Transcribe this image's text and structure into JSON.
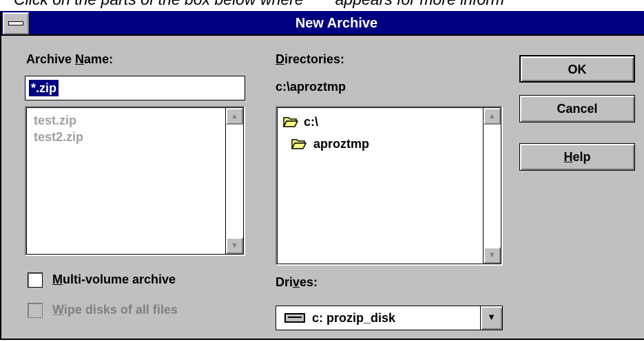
{
  "help_text": {
    "before": "Click on the parts of the box below where",
    "after": "appears for more inform"
  },
  "dialog": {
    "title": "New Archive"
  },
  "archive_name": {
    "label_pre": "Archive ",
    "label_key": "N",
    "label_post": "ame:",
    "value": "*.zip"
  },
  "archive_list": {
    "items": [
      "test.zip",
      "test2.zip"
    ]
  },
  "directories": {
    "label_key": "D",
    "label_post": "irectories:",
    "current_path": "c:\\aproztmp",
    "items": [
      "c:\\",
      "aproztmp"
    ]
  },
  "drives": {
    "label_pre": "Dri",
    "label_key": "v",
    "label_post": "es:",
    "selected": "c: prozip_disk"
  },
  "buttons": {
    "ok": "OK",
    "cancel": "Cancel",
    "help_key": "H",
    "help_post": "elp"
  },
  "options": {
    "multi_volume": {
      "key": "M",
      "post": "ulti-volume archive",
      "checked": false,
      "enabled": true
    },
    "wipe_disks": {
      "key": "W",
      "post": "ipe disks of all files",
      "checked": false,
      "enabled": false
    }
  },
  "icons": {
    "system_menu": "system-menu-icon",
    "scroll_up": "scroll-up-arrow-icon",
    "scroll_down": "scroll-down-arrow-icon",
    "folder_open": "open-folder-icon",
    "drive": "hard-drive-icon",
    "dropdown": "dropdown-arrow-icon"
  },
  "colors": {
    "titlebar": "#000080",
    "dialog_bg": "#c0c0c0",
    "selection": "#000080",
    "disabled_text": "#a0a0a0"
  }
}
